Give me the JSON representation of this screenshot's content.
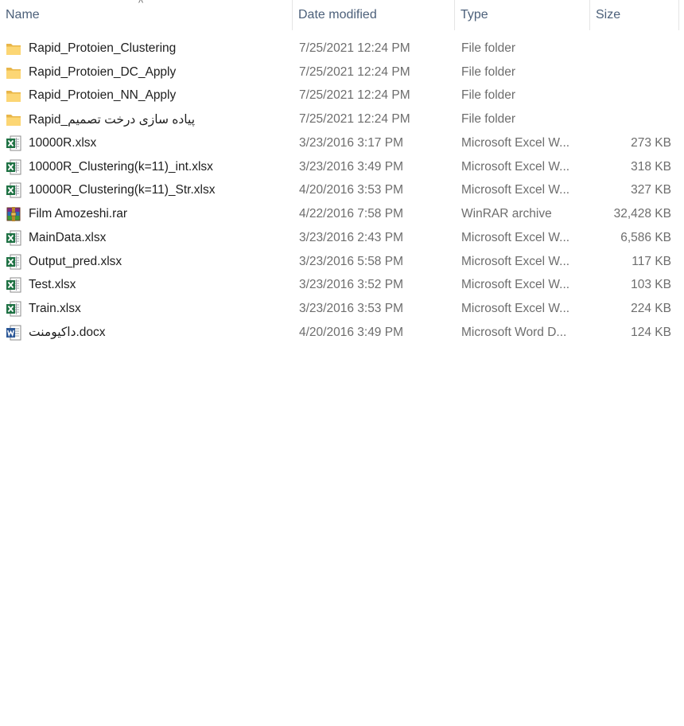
{
  "columns": {
    "name": "Name",
    "date_modified": "Date modified",
    "type": "Type",
    "size": "Size"
  },
  "sort_indicator": "^",
  "files": [
    {
      "name": "Rapid_Protoien_Clustering",
      "date": "7/25/2021 12:24 PM",
      "type": "File folder",
      "size": "",
      "icon": "folder-icon"
    },
    {
      "name": "Rapid_Protoien_DC_Apply",
      "date": "7/25/2021 12:24 PM",
      "type": "File folder",
      "size": "",
      "icon": "folder-icon"
    },
    {
      "name": "Rapid_Protoien_NN_Apply",
      "date": "7/25/2021 12:24 PM",
      "type": "File folder",
      "size": "",
      "icon": "folder-icon"
    },
    {
      "name": "Rapid_پیاده سازی درخت تصمیم",
      "date": "7/25/2021 12:24 PM",
      "type": "File folder",
      "size": "",
      "icon": "folder-icon"
    },
    {
      "name": "10000R.xlsx",
      "date": "3/23/2016 3:17 PM",
      "type": "Microsoft Excel W...",
      "size": "273 KB",
      "icon": "excel-icon"
    },
    {
      "name": "10000R_Clustering(k=11)_int.xlsx",
      "date": "3/23/2016 3:49 PM",
      "type": "Microsoft Excel W...",
      "size": "318 KB",
      "icon": "excel-icon"
    },
    {
      "name": "10000R_Clustering(k=11)_Str.xlsx",
      "date": "4/20/2016 3:53 PM",
      "type": "Microsoft Excel W...",
      "size": "327 KB",
      "icon": "excel-icon"
    },
    {
      "name": "Film Amozeshi.rar",
      "date": "4/22/2016 7:58 PM",
      "type": "WinRAR archive",
      "size": "32,428 KB",
      "icon": "winrar-icon"
    },
    {
      "name": "MainData.xlsx",
      "date": "3/23/2016 2:43 PM",
      "type": "Microsoft Excel W...",
      "size": "6,586 KB",
      "icon": "excel-icon"
    },
    {
      "name": "Output_pred.xlsx",
      "date": "3/23/2016 5:58 PM",
      "type": "Microsoft Excel W...",
      "size": "117 KB",
      "icon": "excel-icon"
    },
    {
      "name": "Test.xlsx",
      "date": "3/23/2016 3:52 PM",
      "type": "Microsoft Excel W...",
      "size": "103 KB",
      "icon": "excel-icon"
    },
    {
      "name": "Train.xlsx",
      "date": "3/23/2016 3:53 PM",
      "type": "Microsoft Excel W...",
      "size": "224 KB",
      "icon": "excel-icon"
    },
    {
      "name": "داکیومنت.docx",
      "date": "4/20/2016 3:49 PM",
      "type": "Microsoft Word D...",
      "size": "124 KB",
      "icon": "word-icon"
    }
  ]
}
